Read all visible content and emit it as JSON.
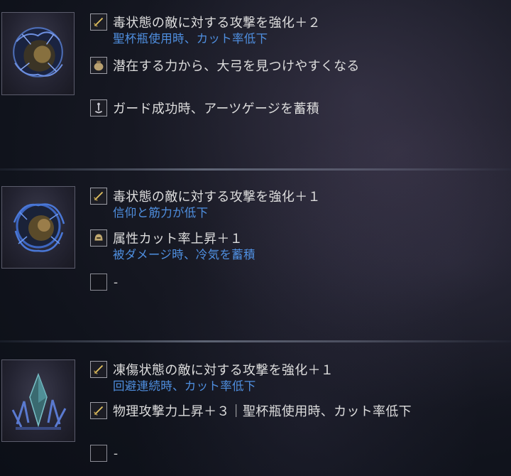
{
  "relics": [
    {
      "icon": "dark-orb-relic-icon",
      "effects": [
        {
          "icon": "sword-icon",
          "main": "毒状態の敵に対する攻撃を強化＋２",
          "sub": "聖杯瓶使用時、カット率低下"
        },
        {
          "icon": "pouch-icon",
          "main": "潜在する力から、大弓を見つけやすくなる",
          "sub": ""
        },
        {
          "icon": "shield-icon",
          "main": "ガード成功時、アーツゲージを蓄積",
          "sub": ""
        }
      ]
    },
    {
      "icon": "blue-orb-relic-icon",
      "effects": [
        {
          "icon": "sword-icon",
          "main": "毒状態の敵に対する攻撃を強化＋１",
          "sub": "信仰と筋力が低下"
        },
        {
          "icon": "helmet-icon",
          "main": "属性カット率上昇＋１",
          "sub": "被ダメージ時、冷気を蓄積"
        },
        {
          "icon": "empty-slot",
          "main": "-",
          "sub": ""
        }
      ]
    },
    {
      "icon": "crystal-relic-icon",
      "effects": [
        {
          "icon": "sword-icon",
          "main": "凍傷状態の敵に対する攻撃を強化＋１",
          "sub": "回避連続時、カット率低下"
        },
        {
          "icon": "sword-icon",
          "main": "物理攻撃力上昇＋３｜聖杯瓶使用時、カット率低下",
          "sub": ""
        },
        {
          "icon": "empty-slot",
          "main": "-",
          "sub": ""
        }
      ]
    }
  ]
}
